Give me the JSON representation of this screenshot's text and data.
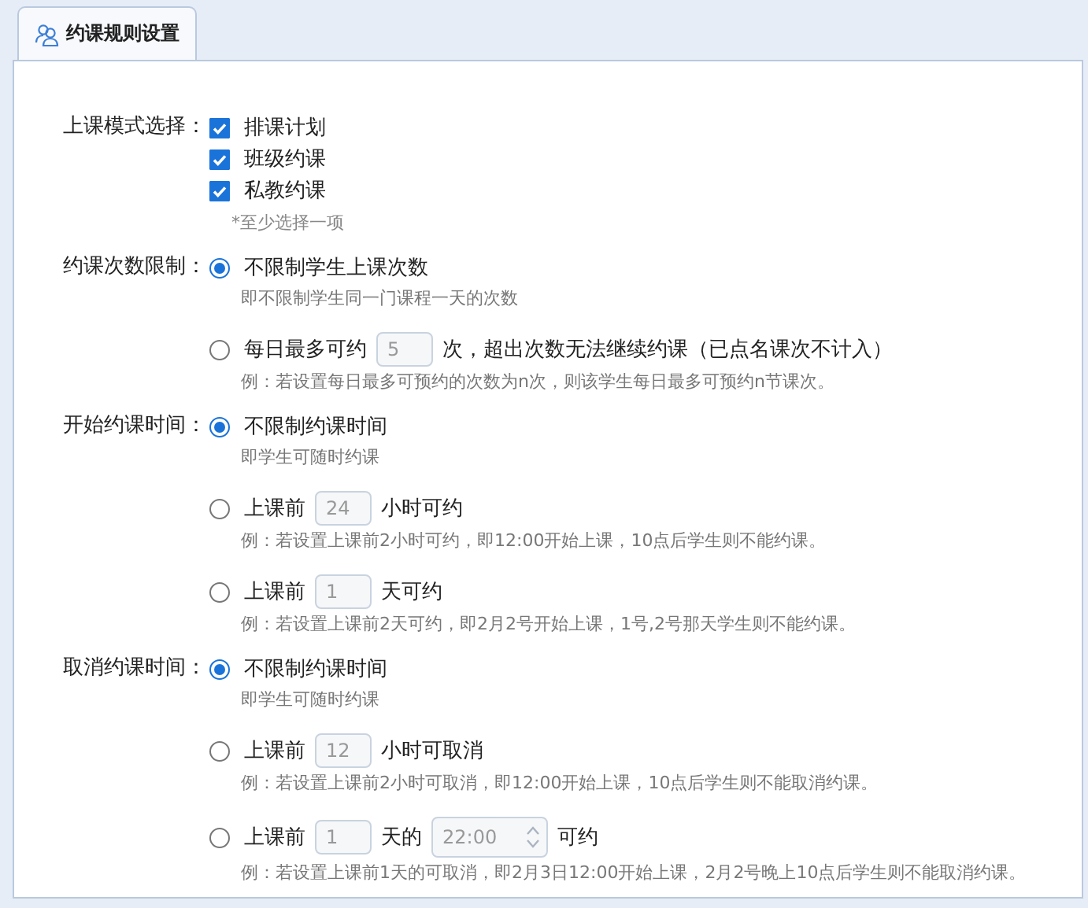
{
  "tab": {
    "label": "约课规则设置",
    "selected": true
  },
  "sections": [
    {
      "label": "上课模式选择：",
      "options": [
        {
          "kind": "checkbox",
          "checked": true,
          "parts": [
            {
              "kind": "text",
              "text": "排课计划"
            }
          ]
        },
        {
          "kind": "checkbox",
          "checked": true,
          "parts": [
            {
              "kind": "text",
              "text": "班级约课"
            }
          ]
        },
        {
          "kind": "checkbox",
          "checked": true,
          "parts": [
            {
              "kind": "text",
              "text": "私教约课"
            }
          ]
        }
      ],
      "note": "*至少选择一项"
    },
    {
      "label": "约课次数限制：",
      "options": [
        {
          "kind": "radio",
          "selected": true,
          "parts": [
            {
              "kind": "text",
              "text": "不限制学生上课次数"
            }
          ],
          "hint": "即不限制学生同一门课程一天的次数"
        },
        {
          "kind": "radio",
          "selected": false,
          "parts": [
            {
              "kind": "text",
              "text": "每日最多可约"
            },
            {
              "kind": "input",
              "value": "5"
            },
            {
              "kind": "text",
              "text": "次，超出次数无法继续约课（已点名课次不计入）"
            }
          ],
          "hint": "例：若设置每日最多可预约的次数为n次，则该学生每日最多可预约n节课次。"
        }
      ]
    },
    {
      "label": "开始约课时间：",
      "options": [
        {
          "kind": "radio",
          "selected": true,
          "parts": [
            {
              "kind": "text",
              "text": "不限制约课时间"
            }
          ],
          "hint": "即学生可随时约课"
        },
        {
          "kind": "radio",
          "selected": false,
          "parts": [
            {
              "kind": "text",
              "text": "上课前"
            },
            {
              "kind": "input",
              "value": "24"
            },
            {
              "kind": "text",
              "text": "小时可约"
            }
          ],
          "hint": "例：若设置上课前2小时可约，即12:00开始上课，10点后学生则不能约课。"
        },
        {
          "kind": "radio",
          "selected": false,
          "parts": [
            {
              "kind": "text",
              "text": "上课前"
            },
            {
              "kind": "input",
              "value": "1"
            },
            {
              "kind": "text",
              "text": "天可约"
            }
          ],
          "hint": "例：若设置上课前2天可约，即2月2号开始上课，1号,2号那天学生则不能约课。"
        }
      ]
    },
    {
      "label": "取消约课时间：",
      "options": [
        {
          "kind": "radio",
          "selected": true,
          "parts": [
            {
              "kind": "text",
              "text": "不限制约课时间"
            }
          ],
          "hint": "即学生可随时约课"
        },
        {
          "kind": "radio",
          "selected": false,
          "parts": [
            {
              "kind": "text",
              "text": "上课前"
            },
            {
              "kind": "input",
              "value": "12"
            },
            {
              "kind": "text",
              "text": "小时可取消"
            }
          ],
          "hint": "例：若设置上课前2小时可取消，即12:00开始上课，10点后学生则不能取消约课。"
        },
        {
          "kind": "radio",
          "selected": false,
          "parts": [
            {
              "kind": "text",
              "text": "上课前"
            },
            {
              "kind": "input",
              "value": "1"
            },
            {
              "kind": "text",
              "text": "天的"
            },
            {
              "kind": "time",
              "value": "22:00"
            },
            {
              "kind": "text",
              "text": "可约"
            }
          ],
          "hint": "例：若设置上课前1天的可取消，即2月3日12:00开始上课，2月2号晚上10点后学生则不能取消约课。"
        }
      ]
    }
  ]
}
